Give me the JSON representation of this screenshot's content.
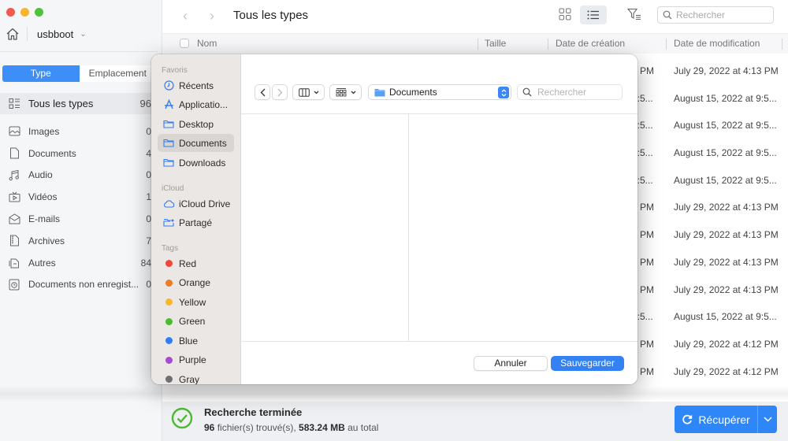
{
  "window": {
    "location_name": "usbboot"
  },
  "sidebar": {
    "segment": {
      "active": "Type",
      "inactive": "Emplacement"
    },
    "categories": [
      {
        "label": "Tous les types",
        "count": "96",
        "icon": "all-types-icon",
        "selected": true
      },
      {
        "label": "Images",
        "count": "0",
        "icon": "image-icon"
      },
      {
        "label": "Documents",
        "count": "4",
        "icon": "document-icon"
      },
      {
        "label": "Audio",
        "count": "0",
        "icon": "audio-icon"
      },
      {
        "label": "Vidéos",
        "count": "1",
        "icon": "video-icon"
      },
      {
        "label": "E-mails",
        "count": "0",
        "icon": "email-icon"
      },
      {
        "label": "Archives",
        "count": "7",
        "icon": "archive-icon"
      },
      {
        "label": "Autres",
        "count": "84",
        "icon": "other-icon"
      },
      {
        "label": "Documents non enregist...",
        "count": "0",
        "icon": "unsaved-doc-icon"
      }
    ]
  },
  "main": {
    "title": "Tous les types",
    "search_placeholder": "Rechercher",
    "columns": {
      "name": "Nom",
      "size": "Taille",
      "created": "Date de création",
      "modified": "Date de modification"
    },
    "rows": [
      {
        "created_tail": "3 PM",
        "modified": "July 29, 2022 at 4:13 PM"
      },
      {
        "created_tail": "9:5...",
        "modified": "August 15, 2022 at 9:5..."
      },
      {
        "created_tail": "9:5...",
        "modified": "August 15, 2022 at 9:5..."
      },
      {
        "created_tail": "9:5...",
        "modified": "August 15, 2022 at 9:5..."
      },
      {
        "created_tail": "9:5...",
        "modified": "August 15, 2022 at 9:5..."
      },
      {
        "created_tail": "3 PM",
        "modified": "July 29, 2022 at 4:13 PM"
      },
      {
        "created_tail": "3 PM",
        "modified": "July 29, 2022 at 4:13 PM"
      },
      {
        "created_tail": "3 PM",
        "modified": "July 29, 2022 at 4:13 PM"
      },
      {
        "created_tail": "3 PM",
        "modified": "July 29, 2022 at 4:13 PM"
      },
      {
        "created_tail": "9:5...",
        "modified": "August 15, 2022 at 9:5..."
      },
      {
        "created_tail": "2 PM",
        "modified": "July 29, 2022 at 4:12 PM"
      },
      {
        "created_tail": "2 PM",
        "modified": "July 29, 2022 at 4:12 PM"
      }
    ]
  },
  "status": {
    "title": "Recherche terminée",
    "file_count": "96",
    "files_text": " fichier(s) trouvé(s), ",
    "total_size": "583.24 MB",
    "total_text": " au total",
    "recover_label": "Récupérer"
  },
  "dialog": {
    "sections": {
      "favorites": "Favoris",
      "icloud": "iCloud",
      "tags": "Tags"
    },
    "favorites": [
      {
        "label": "Récents",
        "icon": "clock-icon"
      },
      {
        "label": "Applicatio...",
        "icon": "applications-icon"
      },
      {
        "label": "Desktop",
        "icon": "folder-icon"
      },
      {
        "label": "Documents",
        "icon": "folder-icon",
        "selected": true
      },
      {
        "label": "Downloads",
        "icon": "folder-icon"
      }
    ],
    "icloud": [
      {
        "label": "iCloud Drive",
        "icon": "cloud-icon"
      },
      {
        "label": "Partagé",
        "icon": "shared-folder-icon"
      }
    ],
    "tags": [
      {
        "label": "Red",
        "color": "#f0473a"
      },
      {
        "label": "Orange",
        "color": "#f07a28"
      },
      {
        "label": "Yellow",
        "color": "#f8b62d"
      },
      {
        "label": "Green",
        "color": "#4cbb2f"
      },
      {
        "label": "Blue",
        "color": "#2f7ef5"
      },
      {
        "label": "Purple",
        "color": "#a54bd1"
      },
      {
        "label": "Gray",
        "color": "#6e6e73"
      }
    ],
    "location": "Documents",
    "search_placeholder": "Rechercher",
    "cancel_label": "Annuler",
    "save_label": "Sauvegarder"
  },
  "colors": {
    "accent": "#3d8ef7",
    "success": "#4cbb2f"
  }
}
